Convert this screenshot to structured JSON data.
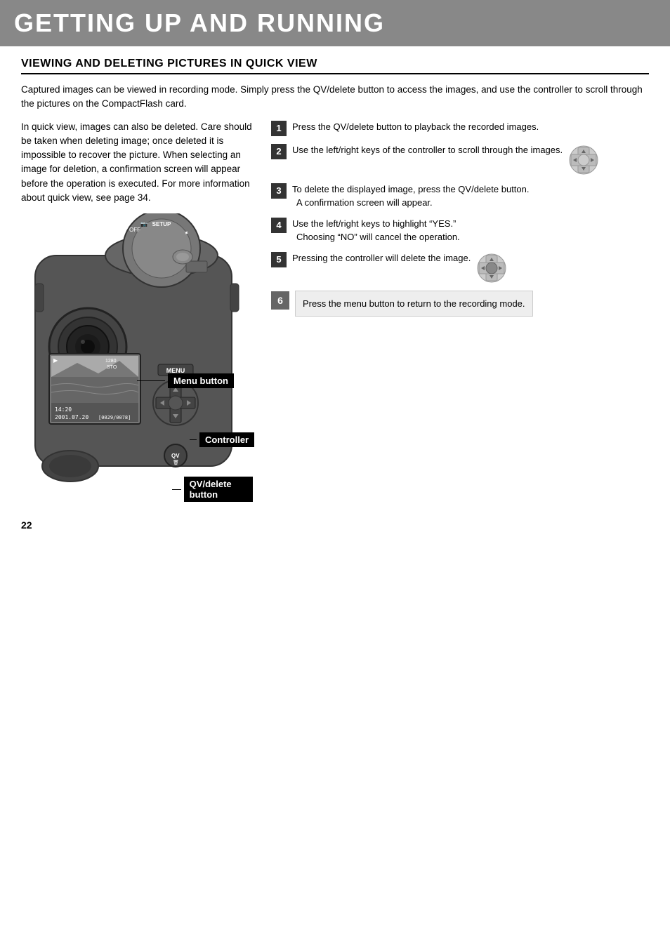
{
  "header": {
    "title": "GETTING UP AND RUNNING"
  },
  "section": {
    "title": "VIEWING AND DELETING PICTURES IN QUICK VIEW"
  },
  "intro": {
    "paragraph1": "Captured images can be viewed in recording mode. Simply press the QV/delete button to access the images, and use the controller to scroll through the pictures on the CompactFlash card.",
    "paragraph2": "In quick view, images can also be deleted. Care should be taken when deleting image; once deleted it is impossible to recover the picture. When selecting an image for deletion, a confirmation screen will appear before the operation is executed. For more information about quick view, see page 34."
  },
  "steps": [
    {
      "number": "1",
      "text": "Press the QV/delete button to playback the recorded images."
    },
    {
      "number": "2",
      "text": "Use the left/right keys of the controller to scroll through the images.",
      "has_icon": true
    },
    {
      "number": "3",
      "text": "To delete the displayed image, press the QV/delete button.",
      "bullet": "A confirmation screen will appear."
    },
    {
      "number": "4",
      "text": "Use the left/right keys to highlight “YES.”",
      "bullet": "Choosing “NO” will cancel the operation."
    },
    {
      "number": "5",
      "text": "Pressing the controller will delete the image.",
      "has_icon": true
    },
    {
      "number": "6",
      "text": "Press the menu button to return to the recording mode."
    }
  ],
  "labels": {
    "menu_button": "Menu button",
    "controller": "Controller",
    "qv_delete": "QV/delete button"
  },
  "camera_display": {
    "time": "14:20",
    "date": "2001.07.20",
    "frame": "[0029/0078]",
    "resolution": "1280",
    "mode": "STO"
  },
  "page_number": "22"
}
